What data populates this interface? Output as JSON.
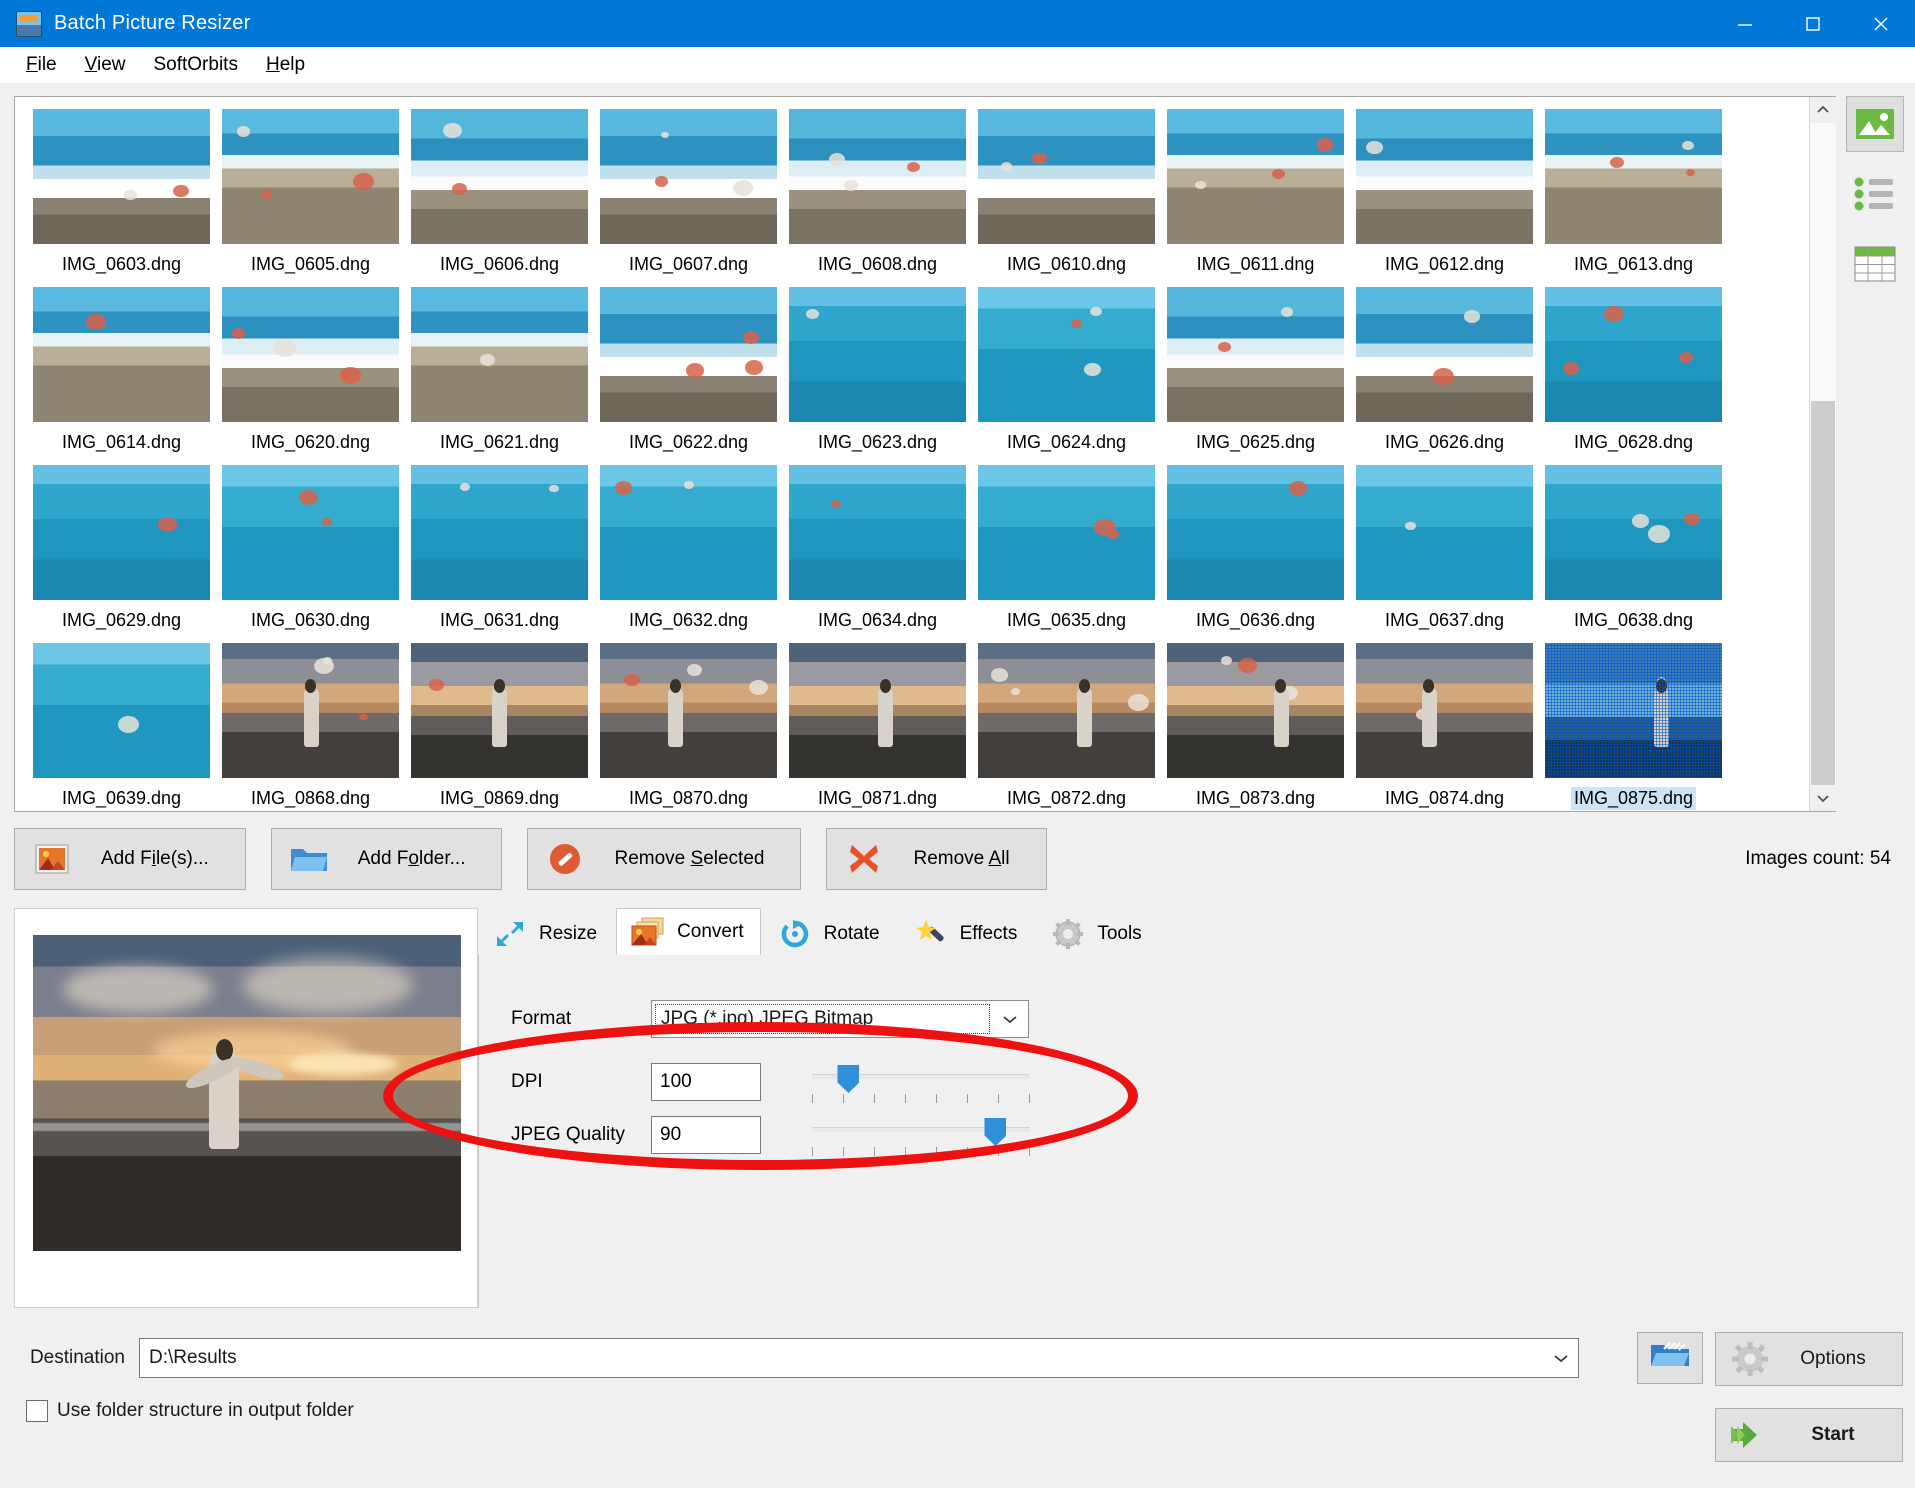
{
  "window": {
    "title": "Batch Picture Resizer",
    "app_icon": "app-icon",
    "minimize": "–",
    "maximize": "☐",
    "close": "✕"
  },
  "menu": [
    {
      "label": "File",
      "accel": "F"
    },
    {
      "label": "View",
      "accel": "V"
    },
    {
      "label": "SoftOrbits",
      "accel": ""
    },
    {
      "label": "Help",
      "accel": "H"
    }
  ],
  "thumbnails": [
    {
      "name": "IMG_0603.dng",
      "style": "p-wave",
      "selected": false
    },
    {
      "name": "IMG_0605.dng",
      "style": "p-pebble",
      "selected": false
    },
    {
      "name": "IMG_0606.dng",
      "style": "p-wave2",
      "selected": false
    },
    {
      "name": "IMG_0607.dng",
      "style": "p-wave",
      "selected": false
    },
    {
      "name": "IMG_0608.dng",
      "style": "p-wave2",
      "selected": false
    },
    {
      "name": "IMG_0610.dng",
      "style": "p-wave",
      "selected": false
    },
    {
      "name": "IMG_0611.dng",
      "style": "p-pebble",
      "selected": false
    },
    {
      "name": "IMG_0612.dng",
      "style": "p-wave2",
      "selected": false
    },
    {
      "name": "IMG_0613.dng",
      "style": "p-pebble",
      "selected": false
    },
    {
      "name": "IMG_0614.dng",
      "style": "p-pebble",
      "selected": false
    },
    {
      "name": "IMG_0620.dng",
      "style": "p-wave2",
      "selected": false
    },
    {
      "name": "IMG_0621.dng",
      "style": "p-pebble",
      "selected": false
    },
    {
      "name": "IMG_0622.dng",
      "style": "p-wave",
      "selected": false
    },
    {
      "name": "IMG_0623.dng",
      "style": "p-open",
      "selected": false
    },
    {
      "name": "IMG_0624.dng",
      "style": "p-open2",
      "selected": false
    },
    {
      "name": "IMG_0625.dng",
      "style": "p-wave2",
      "selected": false
    },
    {
      "name": "IMG_0626.dng",
      "style": "p-wave",
      "selected": false
    },
    {
      "name": "IMG_0628.dng",
      "style": "p-open",
      "selected": false
    },
    {
      "name": "IMG_0629.dng",
      "style": "p-open",
      "selected": false
    },
    {
      "name": "IMG_0630.dng",
      "style": "p-open2",
      "selected": false
    },
    {
      "name": "IMG_0631.dng",
      "style": "p-open",
      "selected": false
    },
    {
      "name": "IMG_0632.dng",
      "style": "p-open2",
      "selected": false
    },
    {
      "name": "IMG_0634.dng",
      "style": "p-open",
      "selected": false
    },
    {
      "name": "IMG_0635.dng",
      "style": "p-open2",
      "selected": false
    },
    {
      "name": "IMG_0636.dng",
      "style": "p-open",
      "selected": false
    },
    {
      "name": "IMG_0637.dng",
      "style": "p-open2",
      "selected": false
    },
    {
      "name": "IMG_0638.dng",
      "style": "p-open",
      "selected": false
    },
    {
      "name": "IMG_0639.dng",
      "style": "p-open2",
      "selected": false
    },
    {
      "name": "IMG_0868.dng",
      "style": "p-dusk",
      "selected": false
    },
    {
      "name": "IMG_0869.dng",
      "style": "p-dusk2",
      "selected": false
    },
    {
      "name": "IMG_0870.dng",
      "style": "p-dusk",
      "selected": false
    },
    {
      "name": "IMG_0871.dng",
      "style": "p-dusk2",
      "selected": false
    },
    {
      "name": "IMG_0872.dng",
      "style": "p-dusk",
      "selected": false
    },
    {
      "name": "IMG_0873.dng",
      "style": "p-dusk2",
      "selected": false
    },
    {
      "name": "IMG_0874.dng",
      "style": "p-dusk",
      "selected": false
    },
    {
      "name": "IMG_0875.dng",
      "style": "p-blue-dusk",
      "selected": true
    }
  ],
  "view_modes": [
    {
      "icon": "thumbnail-view-icon",
      "active": true
    },
    {
      "icon": "list-view-icon",
      "active": false
    },
    {
      "icon": "table-view-icon",
      "active": false
    }
  ],
  "file_buttons": [
    {
      "label": "Add File(s)...",
      "accel": "i",
      "icon": "add-file-icon"
    },
    {
      "label": "Add Folder...",
      "accel": "o",
      "icon": "add-folder-icon"
    },
    {
      "label": "Remove Selected",
      "accel": "S",
      "icon": "remove-selected-icon"
    },
    {
      "label": "Remove All",
      "accel": "A",
      "icon": "remove-all-icon"
    }
  ],
  "images_count_label": "Images count: 54",
  "tabs": [
    {
      "label": "Resize",
      "icon": "resize-icon",
      "active": false
    },
    {
      "label": "Convert",
      "icon": "convert-icon",
      "active": true
    },
    {
      "label": "Rotate",
      "icon": "rotate-icon",
      "active": false
    },
    {
      "label": "Effects",
      "icon": "effects-icon",
      "active": false
    },
    {
      "label": "Tools",
      "icon": "tools-icon",
      "active": false
    }
  ],
  "convert_panel": {
    "format_label": "Format",
    "format_value": "JPG (*.jpg) JPEG Bitmap",
    "dpi_label": "DPI",
    "dpi_value": "100",
    "dpi_slider_percent": 13,
    "jpeg_label": "JPEG Quality",
    "jpeg_value": "90",
    "jpeg_slider_percent": 88
  },
  "annotation": {
    "shape": "ellipse",
    "color": "#ee1111"
  },
  "destination": {
    "label": "Destination",
    "value": "D:\\Results",
    "browse_icon": "browse-folder-icon"
  },
  "use_folder_structure": {
    "label": "Use folder structure in output folder",
    "checked": false
  },
  "options_button": {
    "label": "Options",
    "icon": "gear-icon"
  },
  "start_button": {
    "label": "Start",
    "icon": "start-arrow-icon"
  },
  "colors": {
    "titlebar": "#0078d7",
    "accent_blue": "#2f8fd8",
    "annotation_red": "#ee1111",
    "start_green": "#5ba83f"
  }
}
